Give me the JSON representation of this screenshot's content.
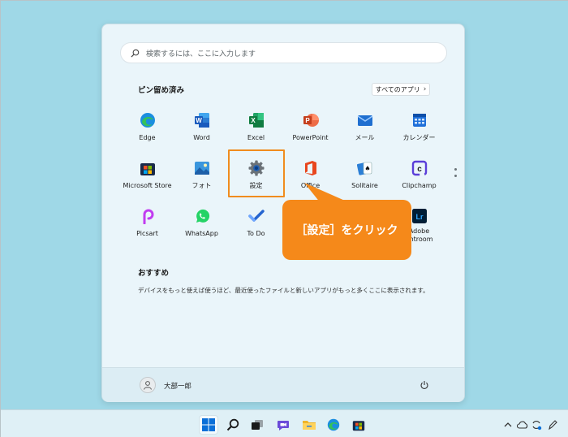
{
  "search": {
    "placeholder": "検索するには、ここに入力します"
  },
  "pinned": {
    "title": "ピン留め済み",
    "all_apps_label": "すべてのアプリ",
    "apps": [
      {
        "label": "Edge",
        "icon": "edge-icon"
      },
      {
        "label": "Word",
        "icon": "word-icon"
      },
      {
        "label": "Excel",
        "icon": "excel-icon"
      },
      {
        "label": "PowerPoint",
        "icon": "powerpoint-icon"
      },
      {
        "label": "メール",
        "icon": "mail-icon"
      },
      {
        "label": "カレンダー",
        "icon": "calendar-icon"
      },
      {
        "label": "Microsoft Store",
        "icon": "store-icon"
      },
      {
        "label": "フォト",
        "icon": "photos-icon"
      },
      {
        "label": "設定",
        "icon": "settings-gear-icon"
      },
      {
        "label": "Office",
        "icon": "office-icon"
      },
      {
        "label": "Solitaire",
        "icon": "solitaire-icon"
      },
      {
        "label": "Clipchamp",
        "icon": "clipchamp-icon"
      },
      {
        "label": "Picsart",
        "icon": "picsart-icon"
      },
      {
        "label": "WhatsApp",
        "icon": "whatsapp-icon"
      },
      {
        "label": "To Do",
        "icon": "todo-icon"
      },
      {
        "label": "Adobe",
        "label2": "ghtroom",
        "icon": "lightroom-icon"
      }
    ]
  },
  "recommended": {
    "title": "おすすめ",
    "text": "デバイスをもっと使えば使うほど、最近使ったファイルと新しいアプリがもっと多くここに表示されます。"
  },
  "user": {
    "name": "大部一郎"
  },
  "callout": {
    "text": "［設定］をクリック"
  },
  "colors": {
    "callout": "#f5891a",
    "accent": "#0067c0",
    "desktop": "#9fd8e7"
  }
}
